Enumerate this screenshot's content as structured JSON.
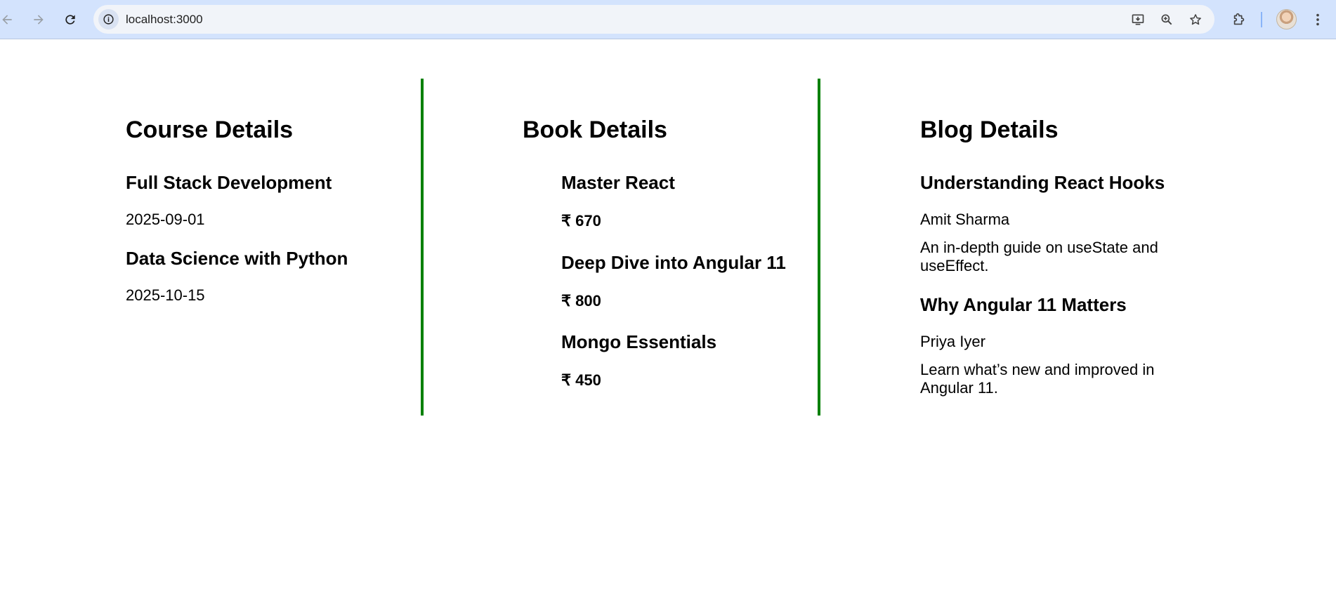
{
  "browser": {
    "url": "localhost:3000",
    "icons": [
      "back-arrow-icon",
      "forward-arrow-icon",
      "reload-icon",
      "site-info-icon",
      "install-app-icon",
      "zoom-icon",
      "bookmark-star-icon",
      "extensions-icon",
      "profile-avatar",
      "more-menu-icon"
    ]
  },
  "courses": {
    "title": "Course Details",
    "items": [
      {
        "name": "Full Stack Development",
        "date": "2025-09-01"
      },
      {
        "name": "Data Science with Python",
        "date": "2025-10-15"
      }
    ]
  },
  "books": {
    "title": "Book Details",
    "items": [
      {
        "name": "Master React",
        "price": "₹ 670"
      },
      {
        "name": "Deep Dive into Angular 11",
        "price": "₹ 800"
      },
      {
        "name": "Mongo Essentials",
        "price": "₹ 450"
      }
    ]
  },
  "blogs": {
    "title": "Blog Details",
    "items": [
      {
        "title": "Understanding React Hooks",
        "author": "Amit Sharma",
        "content": "An in-depth guide on useState and useEffect."
      },
      {
        "title": "Why Angular 11 Matters",
        "author": "Priya Iyer",
        "content": "Learn what’s new and improved in Angular 11."
      }
    ]
  },
  "colors": {
    "divider": "#008000",
    "browser_bar": "#d3e3fd",
    "omnibox": "#f1f4f9"
  }
}
